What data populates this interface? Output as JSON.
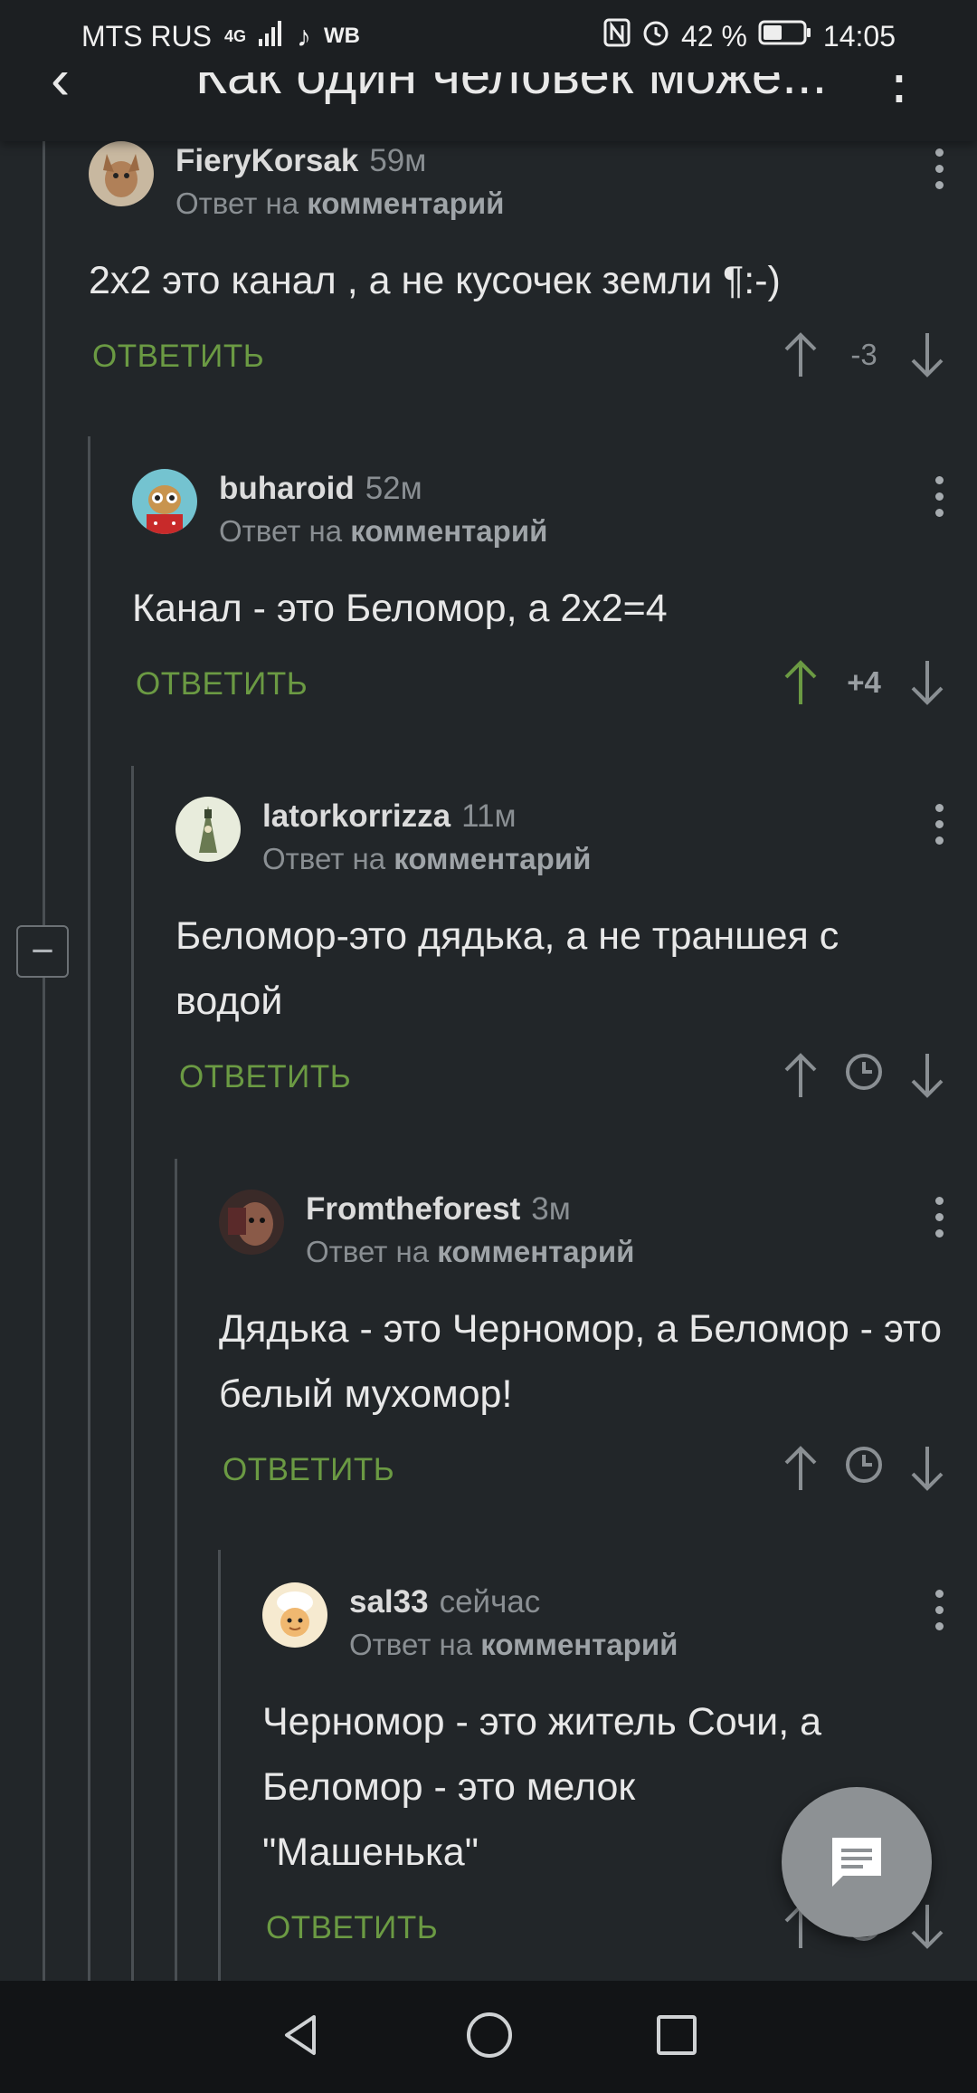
{
  "status_bar": {
    "carrier": "MTS RUS",
    "network": "4G",
    "wb": "WB",
    "battery": "42 %",
    "time": "14:05"
  },
  "header": {
    "title": "Как один человек може..."
  },
  "comments": [
    {
      "user": "FieryKorsak",
      "time": "59м",
      "reply_prefix": "Ответ на",
      "reply_target": "комментарий",
      "text": "2х2 это канал , а не кусочек земли ¶:-)",
      "reply_label": "ОТВЕТИТЬ",
      "score": "-3",
      "upvoted": false
    },
    {
      "user": "buharoid",
      "time": "52м",
      "reply_prefix": "Ответ на",
      "reply_target": "комментарий",
      "text": "Канал - это Беломор, а 2х2=4",
      "reply_label": "ОТВЕТИТЬ",
      "score": "+4",
      "upvoted": true
    },
    {
      "user": "latorkorrizza",
      "time": "11м",
      "reply_prefix": "Ответ на",
      "reply_target": "комментарий",
      "text": "Беломор-это дядька, а не траншея с водой",
      "reply_label": "ОТВЕТИТЬ",
      "score": "",
      "upvoted": false
    },
    {
      "user": "Fromtheforest",
      "time": "3м",
      "reply_prefix": "Ответ на",
      "reply_target": "комментарий",
      "text": "Дядька - это Черномор, а Беломор - это белый мухомор!",
      "reply_label": "ОТВЕТИТЬ",
      "score": "",
      "upvoted": false
    },
    {
      "user": "sal33",
      "time": "сейчас",
      "reply_prefix": "Ответ на",
      "reply_target": "комментарий",
      "text": "Черномор - это житель Сочи, а Беломор - это мелок \"Машенька\"",
      "reply_label": "ОТВЕТИТЬ",
      "score": "",
      "upvoted": false
    }
  ],
  "colors": {
    "background": "#222629",
    "reply_green": "#6b9a43",
    "upvote_green": "#6b9a43",
    "muted": "#8a8f93"
  }
}
